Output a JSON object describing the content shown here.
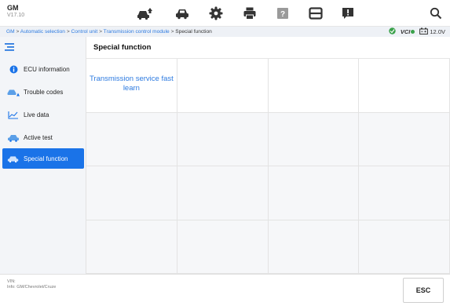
{
  "app": {
    "brand": "GM",
    "version": "V17.10"
  },
  "toolbar": {
    "icons": [
      "car-home-icon",
      "car-icon",
      "gear-icon",
      "print-icon",
      "help-icon",
      "window-icon",
      "feedback-icon",
      "search-icon"
    ]
  },
  "breadcrumb": {
    "items": [
      "GM",
      "Automatic selection",
      "Control unit",
      "Transmission control module",
      "Special function"
    ],
    "separator": ">"
  },
  "status": {
    "vci_label": "VCI",
    "voltage": "12.0V"
  },
  "sidebar": {
    "items": [
      {
        "label": "ECU information",
        "icon": "info-icon",
        "active": false
      },
      {
        "label": "Trouble codes",
        "icon": "car-warning-icon",
        "active": false
      },
      {
        "label": "Live data",
        "icon": "line-chart-icon",
        "active": false
      },
      {
        "label": "Active test",
        "icon": "car-test-icon",
        "active": false
      },
      {
        "label": "Special function",
        "icon": "car-special-icon",
        "active": true
      }
    ]
  },
  "main": {
    "title": "Special function",
    "functions": [
      "Transmission service fast learn"
    ]
  },
  "footer": {
    "vin": "VIN:",
    "info": "Info: GM/Chevrolet/Cruze",
    "esc_label": "ESC"
  },
  "colors": {
    "accent": "#1a73e8",
    "link": "#2e7be0"
  }
}
